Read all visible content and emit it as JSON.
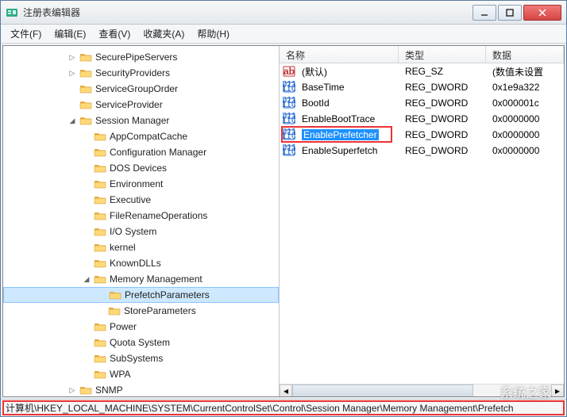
{
  "window": {
    "title": "注册表编辑器"
  },
  "menu": {
    "file": "文件(F)",
    "edit": "编辑(E)",
    "view": "查看(V)",
    "fav": "收藏夹(A)",
    "help": "帮助(H)"
  },
  "tree": [
    {
      "depth": 4,
      "toggle": "closed",
      "label": "SecurePipeServers"
    },
    {
      "depth": 4,
      "toggle": "closed",
      "label": "SecurityProviders"
    },
    {
      "depth": 4,
      "toggle": "none",
      "label": "ServiceGroupOrder"
    },
    {
      "depth": 4,
      "toggle": "none",
      "label": "ServiceProvider"
    },
    {
      "depth": 4,
      "toggle": "open",
      "label": "Session Manager"
    },
    {
      "depth": 5,
      "toggle": "none",
      "label": "AppCompatCache"
    },
    {
      "depth": 5,
      "toggle": "none",
      "label": "Configuration Manager"
    },
    {
      "depth": 5,
      "toggle": "none",
      "label": "DOS Devices"
    },
    {
      "depth": 5,
      "toggle": "none",
      "label": "Environment"
    },
    {
      "depth": 5,
      "toggle": "none",
      "label": "Executive"
    },
    {
      "depth": 5,
      "toggle": "none",
      "label": "FileRenameOperations"
    },
    {
      "depth": 5,
      "toggle": "none",
      "label": "I/O System"
    },
    {
      "depth": 5,
      "toggle": "none",
      "label": "kernel"
    },
    {
      "depth": 5,
      "toggle": "none",
      "label": "KnownDLLs"
    },
    {
      "depth": 5,
      "toggle": "open",
      "label": "Memory Management"
    },
    {
      "depth": 6,
      "toggle": "none",
      "label": "PrefetchParameters",
      "selected": true
    },
    {
      "depth": 6,
      "toggle": "none",
      "label": "StoreParameters"
    },
    {
      "depth": 5,
      "toggle": "none",
      "label": "Power"
    },
    {
      "depth": 5,
      "toggle": "none",
      "label": "Quota System"
    },
    {
      "depth": 5,
      "toggle": "none",
      "label": "SubSystems"
    },
    {
      "depth": 5,
      "toggle": "none",
      "label": "WPA"
    },
    {
      "depth": 4,
      "toggle": "closed",
      "label": "SNMP"
    }
  ],
  "list": {
    "cols": {
      "name": "名称",
      "type": "类型",
      "data": "数据"
    },
    "rows": [
      {
        "icon": "ab",
        "name": "(默认)",
        "type": "REG_SZ",
        "data": "(数值未设置"
      },
      {
        "icon": "bin",
        "name": "BaseTime",
        "type": "REG_DWORD",
        "data": "0x1e9a322"
      },
      {
        "icon": "bin",
        "name": "BootId",
        "type": "REG_DWORD",
        "data": "0x000001c"
      },
      {
        "icon": "bin",
        "name": "EnableBootTrace",
        "type": "REG_DWORD",
        "data": "0x0000000"
      },
      {
        "icon": "bin",
        "name": "EnablePrefetcher",
        "type": "REG_DWORD",
        "data": "0x0000000",
        "selected": true,
        "boxed": true
      },
      {
        "icon": "bin",
        "name": "EnableSuperfetch",
        "type": "REG_DWORD",
        "data": "0x0000000"
      }
    ]
  },
  "status": {
    "path": "计算机\\HKEY_LOCAL_MACHINE\\SYSTEM\\CurrentControlSet\\Control\\Session Manager\\Memory Management\\Prefetch"
  },
  "watermark": "系统之家"
}
